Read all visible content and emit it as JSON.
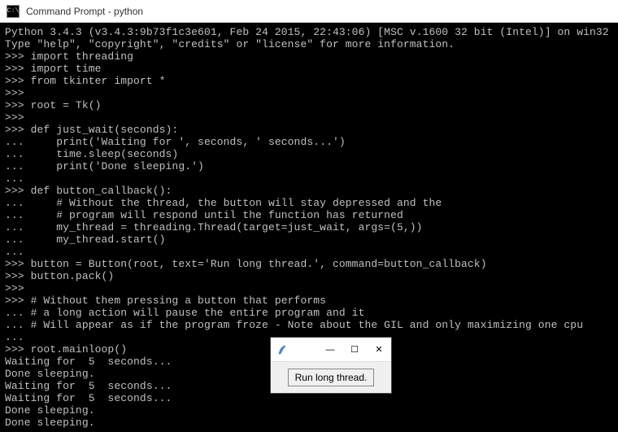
{
  "window": {
    "title": "Command Prompt - python",
    "icon_label": "C:\\"
  },
  "terminal_text": "Python 3.4.3 (v3.4.3:9b73f1c3e601, Feb 24 2015, 22:43:06) [MSC v.1600 32 bit (Intel)] on win32\nType \"help\", \"copyright\", \"credits\" or \"license\" for more information.\n>>> import threading\n>>> import time\n>>> from tkinter import *\n>>>\n>>> root = Tk()\n>>>\n>>> def just_wait(seconds):\n...     print('Waiting for ', seconds, ' seconds...')\n...     time.sleep(seconds)\n...     print('Done sleeping.')\n...\n>>> def button_callback():\n...     # Without the thread, the button will stay depressed and the\n...     # program will respond until the function has returned\n...     my_thread = threading.Thread(target=just_wait, args=(5,))\n...     my_thread.start()\n...\n>>> button = Button(root, text='Run long thread.', command=button_callback)\n>>> button.pack()\n>>>\n>>> # Without them pressing a button that performs\n... # a long action will pause the entire program and it\n... # Will appear as if the program froze - Note about the GIL and only maximizing one cpu\n...\n>>> root.mainloop()\nWaiting for  5  seconds...\nDone sleeping.\nWaiting for  5  seconds...\nWaiting for  5  seconds...\nDone sleeping.\nDone sleeping.",
  "tk_window": {
    "button_label": "Run long thread.",
    "minimize": "—",
    "maximize": "☐",
    "close": "✕"
  }
}
